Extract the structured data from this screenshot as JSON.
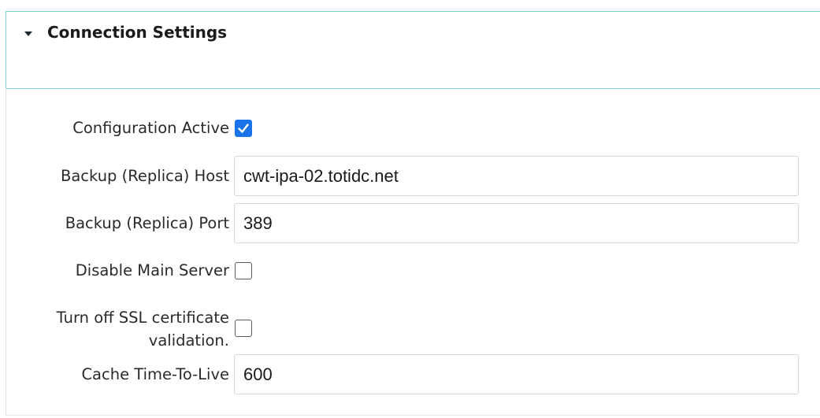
{
  "section": {
    "title": "Connection Settings",
    "expanded": true
  },
  "fields": {
    "configuration_active": {
      "label": "Configuration Active",
      "checked": true
    },
    "backup_host": {
      "label": "Backup (Replica) Host",
      "value": "cwt-ipa-02.totidc.net"
    },
    "backup_port": {
      "label": "Backup (Replica) Port",
      "value": "389"
    },
    "disable_main_server": {
      "label": "Disable Main Server",
      "checked": false
    },
    "ssl_validation_off": {
      "label_line1": "Turn off SSL certificate",
      "label_line2": "validation.",
      "checked": false
    },
    "cache_ttl": {
      "label": "Cache Time-To-Live",
      "value": "600"
    }
  },
  "colors": {
    "header_border": "#7fd3d8",
    "checkbox_checked": "#1a73e8"
  },
  "icons": {
    "section_toggle": "caret-down-icon",
    "checkmark": "checkmark-icon"
  }
}
